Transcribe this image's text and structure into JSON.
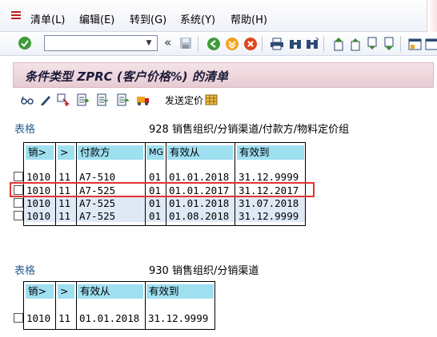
{
  "menu": {
    "items": [
      "清单(L)",
      "编辑(E)",
      "转到(G)",
      "系统(Y)",
      "帮助(H)"
    ]
  },
  "toolbar": {
    "command_value": "",
    "back_glyph": "«"
  },
  "title": "条件类型 ZPRC (客户价格%) 的清单",
  "app_toolbar": {
    "send_price_label": "发送定价"
  },
  "sections": [
    {
      "label": "表格",
      "description": "928 销售组织/分销渠道/付款方/物料定价组",
      "columns": [
        "销>",
        ">",
        "付款方",
        "MG",
        "有效从",
        "有效到"
      ],
      "rows": [
        [
          "1010",
          "11",
          "A7-510",
          "01",
          "01.01.2018",
          "31.12.9999"
        ],
        [
          "1010",
          "11",
          "A7-525",
          "01",
          "01.01.2017",
          "31.12.2017"
        ],
        [
          "1010",
          "11",
          "A7-525",
          "01",
          "01.01.2018",
          "31.07.2018"
        ],
        [
          "1010",
          "11",
          "A7-525",
          "01",
          "01.08.2018",
          "31.12.9999"
        ]
      ]
    },
    {
      "label": "表格",
      "description": "930 销售组织/分销渠道",
      "columns": [
        "销>",
        ">",
        "有效从",
        "有效到"
      ],
      "rows": [
        [
          "1010",
          "11",
          "01.01.2018",
          "31.12.9999"
        ]
      ]
    }
  ],
  "colors": {
    "header_bg": "#9edff0",
    "title_bg": "#ecd4da",
    "highlight": "#e53232",
    "section_label": "#2a6190"
  }
}
